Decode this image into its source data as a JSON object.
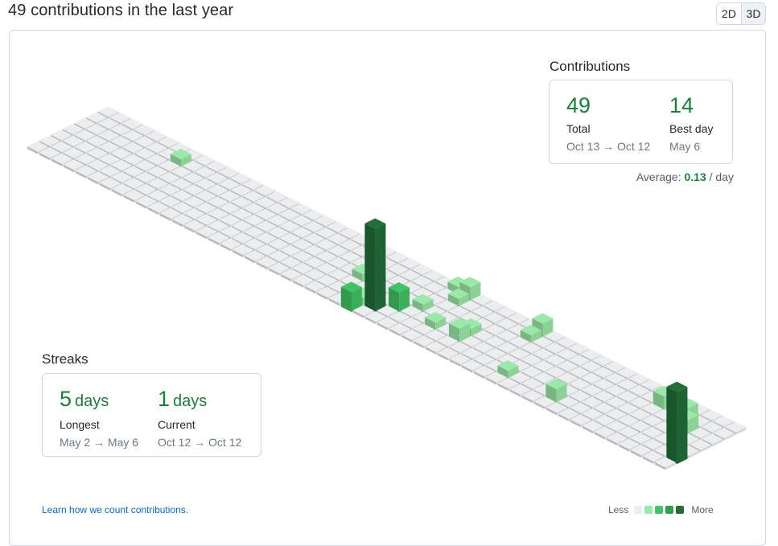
{
  "header": {
    "title": "49 contributions in the last year",
    "view_toggle": [
      {
        "label": "2D",
        "active": false
      },
      {
        "label": "3D",
        "active": true
      }
    ]
  },
  "contributions": {
    "heading": "Contributions",
    "total": {
      "value": "49",
      "label": "Total",
      "range": "Oct 13 → Oct 12"
    },
    "best_day": {
      "value": "14",
      "label": "Best day",
      "range": "May 6"
    },
    "average": {
      "prefix": "Average:",
      "value": "0.13",
      "suffix": "/ day"
    }
  },
  "streaks": {
    "heading": "Streaks",
    "longest": {
      "value": "5",
      "unit": "days",
      "label": "Longest",
      "range": "May 2 → May 6"
    },
    "current": {
      "value": "1",
      "unit": "days",
      "label": "Current",
      "range": "Oct 12 → Oct 12"
    }
  },
  "footer": {
    "learn_link": "Learn how we count contributions.",
    "legend_less": "Less",
    "legend_more": "More"
  },
  "colors": {
    "level0": "#ebedf0",
    "level1": "#9be9a8",
    "level2": "#40c463",
    "level3": "#30a14e",
    "level4": "#216e39",
    "accent": "#1a7f37",
    "link": "#0969da"
  },
  "calendar": {
    "weeks": 53,
    "days_per_week": 7,
    "active_days": [
      {
        "week": 7,
        "day": 5,
        "count": 1
      },
      {
        "week": 24,
        "day": 3,
        "count": 1
      },
      {
        "week": 26,
        "day": 1,
        "count": 1
      },
      {
        "week": 26,
        "day": 0,
        "count": 3
      },
      {
        "week": 27,
        "day": 1,
        "count": 14
      },
      {
        "week": 28,
        "day": 2,
        "count": 3
      },
      {
        "week": 29,
        "day": 3,
        "count": 1
      },
      {
        "week": 29,
        "day": 6,
        "count": 1
      },
      {
        "week": 30,
        "day": 5,
        "count": 1
      },
      {
        "week": 30,
        "day": 6,
        "count": 2
      },
      {
        "week": 31,
        "day": 2,
        "count": 1
      },
      {
        "week": 33,
        "day": 3,
        "count": 1
      },
      {
        "week": 33,
        "day": 2,
        "count": 2
      },
      {
        "week": 36,
        "day": 6,
        "count": 2
      },
      {
        "week": 36,
        "day": 5,
        "count": 1
      },
      {
        "week": 38,
        "day": 1,
        "count": 1
      },
      {
        "week": 42,
        "day": 1,
        "count": 2
      },
      {
        "week": 47,
        "day": 5,
        "count": 2
      },
      {
        "week": 49,
        "day": 5,
        "count": 2
      },
      {
        "week": 50,
        "day": 4,
        "count": 2
      },
      {
        "week": 52,
        "day": 1,
        "count": 12
      }
    ]
  }
}
